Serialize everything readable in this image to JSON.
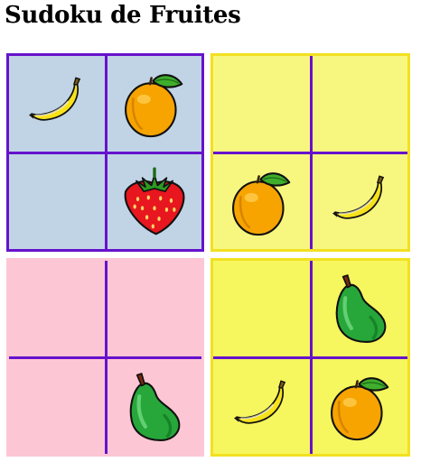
{
  "title": "Sudoku de Fruites",
  "colors": {
    "q1_bg": "#c0d4e6",
    "q2_bg": "#f7f780",
    "q3_bg": "#fdc6d4",
    "q4_bg": "#f6f65e",
    "divider": "#6612cc",
    "q2_border": "#f2e020",
    "q3_border": "#fdc6d4",
    "q4_border": "#f2e020"
  },
  "quadrants": [
    {
      "id": "q1",
      "bg": "q1_bg",
      "border": "divider",
      "cells": [
        "banana",
        "orange",
        "",
        "strawberry"
      ]
    },
    {
      "id": "q2",
      "bg": "q2_bg",
      "border": "q2_border",
      "cells": [
        "",
        "",
        "orange",
        "banana"
      ]
    },
    {
      "id": "q3",
      "bg": "q3_bg",
      "border": "q3_border",
      "cells": [
        "",
        "",
        "",
        "pear"
      ]
    },
    {
      "id": "q4",
      "bg": "q4_bg",
      "border": "q4_border",
      "cells": [
        "",
        "pear",
        "banana",
        "orange"
      ]
    }
  ]
}
